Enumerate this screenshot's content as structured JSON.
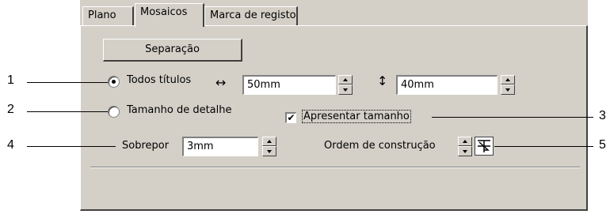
{
  "tabs": [
    {
      "label": "Plano"
    },
    {
      "label": "Mosaicos"
    },
    {
      "label": "Marca de registo"
    }
  ],
  "separacao_button": "Separação",
  "options": {
    "todos_titulos": {
      "label": "Todos títulos",
      "selected": true
    },
    "tamanho_detalhe": {
      "label": "Tamanho de detalhe",
      "selected": false
    }
  },
  "width_icon": "horizontal-arrows-icon",
  "width_value": "50mm",
  "height_icon": "vertical-arrows-icon",
  "height_value": "40mm",
  "apresentar": {
    "label": "Apresentar tamanho",
    "checked": true
  },
  "sobrepor": {
    "label": "Sobrepor",
    "value": "3mm"
  },
  "ordem": {
    "label": "Ordem de construção"
  },
  "callouts": [
    "1",
    "2",
    "3",
    "4",
    "5"
  ]
}
